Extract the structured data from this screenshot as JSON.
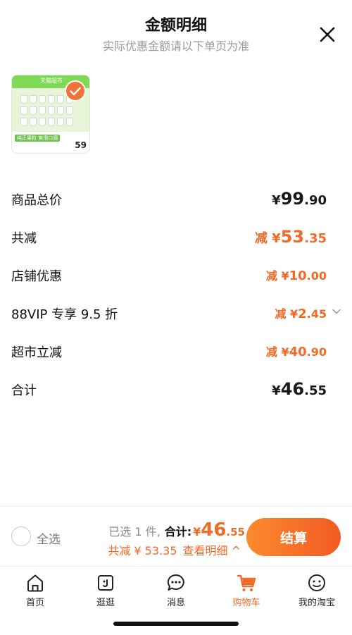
{
  "header": {
    "title": "金额明细",
    "subtitle": "实际优惠金额请以下单页为准"
  },
  "product": {
    "store_banner": "天猫超市",
    "tag": "纯正果粒 爽滑口感",
    "price_badge": "59"
  },
  "breakdown": {
    "total_price": {
      "label": "商品总价",
      "yen": "¥",
      "int": "99",
      "dec": ".90"
    },
    "total_reduce": {
      "label": "共减",
      "prefix": "减 ¥",
      "int": "53",
      "dec": ".35"
    },
    "store_discount": {
      "label": "店铺优惠",
      "prefix": "减 ¥",
      "int": "10",
      "dec": ".00"
    },
    "vip_discount": {
      "label": "88VIP 专享 9.5 折",
      "prefix": "减 ¥",
      "int": "2",
      "dec": ".45"
    },
    "market_reduce": {
      "label": "超市立减",
      "prefix": "减 ¥",
      "int": "40",
      "dec": ".90"
    },
    "subtotal": {
      "label": "合计",
      "yen": "¥",
      "int": "46",
      "dec": ".55"
    }
  },
  "bottom_bar": {
    "select_all": "全选",
    "selected_count": "已选 1 件,",
    "total_label": "合计:",
    "total_yen": "¥",
    "total_int": "46",
    "total_dec": ".55",
    "reduce_text": "共减 ¥ 53.35",
    "view_detail": "查看明细 ^",
    "checkout": "结算"
  },
  "tabbar": {
    "items": [
      {
        "label": "首页",
        "icon": "home-icon"
      },
      {
        "label": "逛逛",
        "icon": "explore-icon"
      },
      {
        "label": "消息",
        "icon": "message-icon"
      },
      {
        "label": "购物车",
        "icon": "cart-icon"
      },
      {
        "label": "我的淘宝",
        "icon": "profile-icon"
      }
    ]
  },
  "colors": {
    "accent": "#f06a28",
    "text": "#1a1a1a",
    "muted": "#9a9a9a"
  }
}
